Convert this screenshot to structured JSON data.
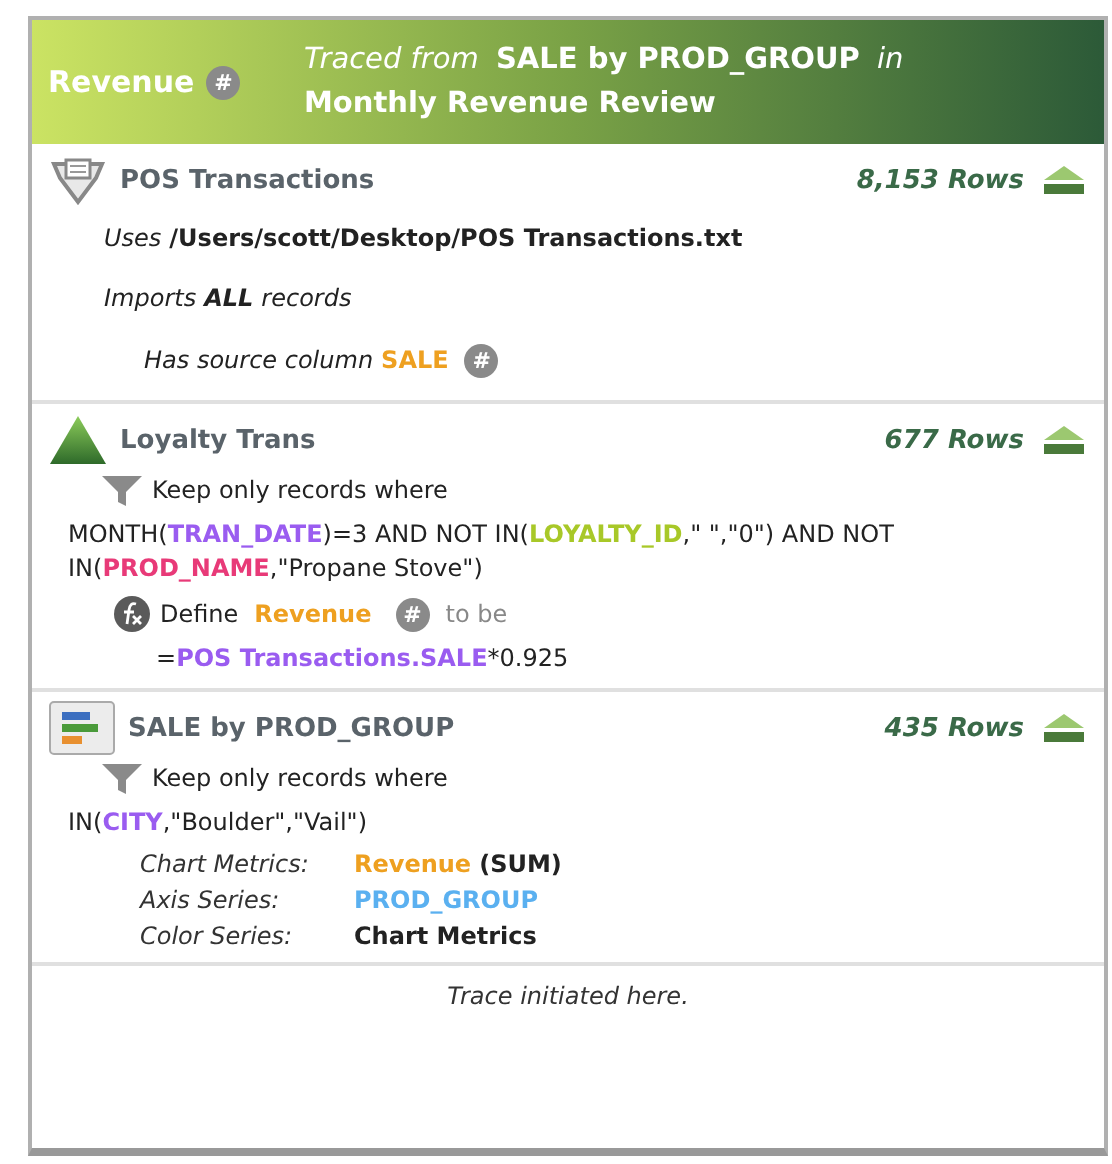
{
  "header": {
    "title": "Revenue",
    "title_badge": "#",
    "trace": [
      {
        "kind": "em",
        "text": "Traced from"
      },
      {
        "kind": "strong",
        "text": "SALE by PROD_GROUP"
      },
      {
        "kind": "em",
        "text": "in"
      },
      {
        "kind": "strong",
        "text": "Monthly Revenue Review"
      }
    ]
  },
  "steps": [
    {
      "kind": "source",
      "title": "POS Transactions",
      "rows": "8,153 Rows",
      "lines": [
        {
          "kind": "note",
          "parts": [
            {
              "kind": "em",
              "text": "Uses"
            },
            {
              "kind": "strong",
              "text": "/Users/scott/Desktop/POS Transactions.txt"
            }
          ]
        },
        {
          "kind": "note",
          "parts": [
            {
              "kind": "em",
              "text": "Imports"
            },
            {
              "kind": "strong-em",
              "text": "ALL"
            },
            {
              "kind": "em",
              "text": "records"
            }
          ]
        },
        {
          "kind": "subnote",
          "parts": [
            {
              "kind": "em",
              "text": "Has source column"
            },
            {
              "kind": "field",
              "text": "SALE",
              "color": "#eea020"
            },
            {
              "kind": "badge",
              "text": "#"
            }
          ]
        }
      ]
    },
    {
      "kind": "filter",
      "title": "Loyalty Trans",
      "rows": "677 Rows",
      "lines": [
        {
          "kind": "filter",
          "parts": [
            {
              "kind": "text",
              "text": "Keep only records where"
            }
          ]
        },
        {
          "kind": "expr",
          "parts": [
            {
              "kind": "text",
              "text": "MONTH("
            },
            {
              "kind": "field",
              "text": "TRAN_DATE",
              "color": "#9a5cf0"
            },
            {
              "kind": "text",
              "text": ")=3 AND NOT IN("
            },
            {
              "kind": "field",
              "text": "LOYALTY_ID",
              "color": "#a8c828"
            },
            {
              "kind": "text",
              "text": ",\" \",\"0\") AND NOT IN("
            },
            {
              "kind": "field",
              "text": "PROD_NAME",
              "color": "#e83a78"
            },
            {
              "kind": "text",
              "text": ",\"Propane Stove\")"
            }
          ]
        },
        {
          "kind": "define",
          "parts": [
            {
              "kind": "text",
              "text": "Define"
            },
            {
              "kind": "field",
              "text": "Revenue",
              "color": "#eea020"
            },
            {
              "kind": "badge",
              "text": "#"
            },
            {
              "kind": "muted",
              "text": "to be"
            }
          ]
        },
        {
          "kind": "formula",
          "parts": [
            {
              "kind": "text",
              "text": "="
            },
            {
              "kind": "field",
              "text": "POS Transactions.SALE",
              "color": "#9a5cf0"
            },
            {
              "kind": "text",
              "text": "*0.925"
            }
          ]
        }
      ]
    },
    {
      "kind": "chart",
      "title": "SALE by PROD_GROUP",
      "rows": "435 Rows",
      "lines": [
        {
          "kind": "filter",
          "parts": [
            {
              "kind": "text",
              "text": "Keep only records where"
            }
          ]
        },
        {
          "kind": "expr",
          "parts": [
            {
              "kind": "text",
              "text": "IN("
            },
            {
              "kind": "field",
              "text": "CITY",
              "color": "#9a5cf0"
            },
            {
              "kind": "text",
              "text": ",\"Boulder\",\"Vail\")"
            }
          ]
        },
        {
          "kind": "property",
          "label": "Chart Metrics:",
          "parts": [
            {
              "kind": "field",
              "text": "Revenue",
              "color": "#eea020"
            },
            {
              "kind": "strong",
              "text": "(SUM)"
            }
          ]
        },
        {
          "kind": "property",
          "label": "Axis Series:",
          "parts": [
            {
              "kind": "field",
              "text": "PROD_GROUP",
              "color": "#5ab0f0"
            }
          ]
        },
        {
          "kind": "property",
          "label": "Color Series:",
          "parts": [
            {
              "kind": "strong",
              "text": "Chart Metrics"
            }
          ]
        }
      ]
    }
  ],
  "footer": "Trace initiated here."
}
